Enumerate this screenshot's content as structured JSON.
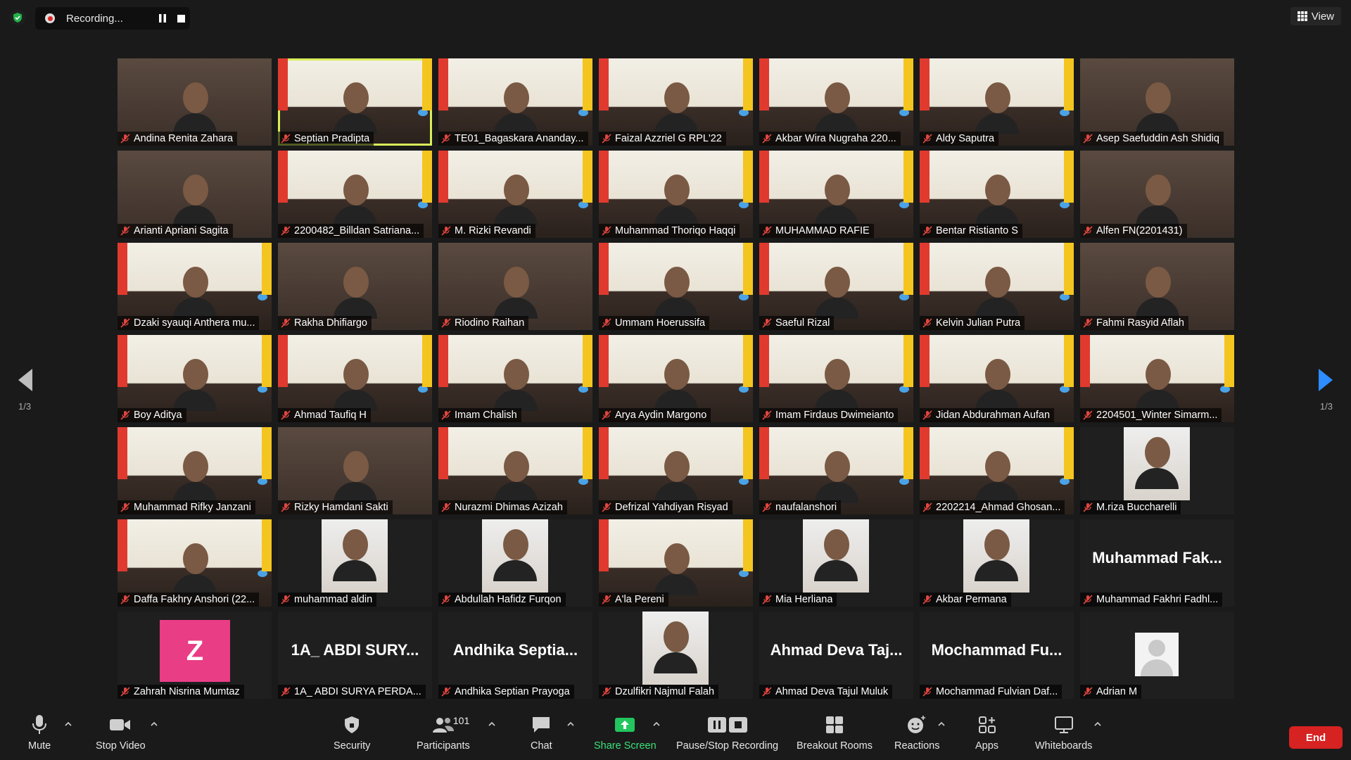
{
  "recording": {
    "label": "Recording..."
  },
  "view": {
    "label": "View"
  },
  "pagination": {
    "left": "1/3",
    "right": "1/3"
  },
  "participants_grid": [
    {
      "name": "Andina Renita Zahara",
      "type": "cam"
    },
    {
      "name": "Septian Pradipta",
      "type": "video",
      "active": true
    },
    {
      "name": "TE01_Bagaskara Ananday...",
      "type": "video"
    },
    {
      "name": "Faizal Azzriel G RPL'22",
      "type": "video"
    },
    {
      "name": "Akbar Wira Nugraha 220...",
      "type": "video"
    },
    {
      "name": "Aldy Saputra",
      "type": "video"
    },
    {
      "name": "Asep Saefuddin Ash Shidiq",
      "type": "cam"
    },
    {
      "name": "Arianti Apriani Sagita",
      "type": "cam"
    },
    {
      "name": "2200482_Billdan Satriana...",
      "type": "video"
    },
    {
      "name": "M. Rizki Revandi",
      "type": "video"
    },
    {
      "name": "Muhammad Thoriqo Haqqi",
      "type": "video"
    },
    {
      "name": "MUHAMMAD RAFIE",
      "type": "video"
    },
    {
      "name": "Bentar Ristianto S",
      "type": "video"
    },
    {
      "name": "Alfen FN(2201431)",
      "type": "cam"
    },
    {
      "name": "Dzaki syauqi Anthera mu...",
      "type": "video"
    },
    {
      "name": "Rakha Dhifiargo",
      "type": "cam"
    },
    {
      "name": "Riodino Raihan",
      "type": "cam"
    },
    {
      "name": "Ummam Hoerussifa",
      "type": "video"
    },
    {
      "name": "Saeful Rizal",
      "type": "video"
    },
    {
      "name": "Kelvin Julian Putra",
      "type": "video"
    },
    {
      "name": "Fahmi Rasyid Aflah",
      "type": "cam"
    },
    {
      "name": "Boy Aditya",
      "type": "video"
    },
    {
      "name": "Ahmad Taufiq H",
      "type": "video"
    },
    {
      "name": "Imam Chalish",
      "type": "video"
    },
    {
      "name": "Arya Aydin Margono",
      "type": "video"
    },
    {
      "name": "Imam Firdaus Dwimeianto",
      "type": "video"
    },
    {
      "name": "Jidan Abdurahman Aufan",
      "type": "video"
    },
    {
      "name": "2204501_Winter Simarm...",
      "type": "video"
    },
    {
      "name": "Muhammad Rifky Janzani",
      "type": "video"
    },
    {
      "name": "Rizky Hamdani Sakti",
      "type": "cam"
    },
    {
      "name": "Nurazmi Dhimas Azizah",
      "type": "video"
    },
    {
      "name": "Defrizal Yahdiyan Risyad",
      "type": "video"
    },
    {
      "name": "naufalanshori",
      "type": "video"
    },
    {
      "name": "2202214_Ahmad Ghosan...",
      "type": "video"
    },
    {
      "name": "M.riza Buccharelli",
      "type": "photo"
    },
    {
      "name": "Daffa Fakhry Anshori (22...",
      "type": "video"
    },
    {
      "name": "muhammad aldin",
      "type": "photo"
    },
    {
      "name": "Abdullah Hafidz Furqon",
      "type": "photo"
    },
    {
      "name": "A'la Pereni",
      "type": "video"
    },
    {
      "name": "Mia Herliana",
      "type": "photo"
    },
    {
      "name": "Akbar Permana",
      "type": "photo"
    },
    {
      "name": "Muhammad Fakhri Fadhl...",
      "type": "text",
      "big": "Muhammad  Fak..."
    },
    {
      "name": "Zahrah Nisrina Mumtaz",
      "type": "letter",
      "letter": "Z"
    },
    {
      "name": "1A_ ABDI SURYA PERDA...",
      "type": "text",
      "big": "1A_ ABDI SURY..."
    },
    {
      "name": "Andhika Septian Prayoga",
      "type": "text",
      "big": "Andhika  Septia..."
    },
    {
      "name": "Dzulfikri Najmul Falah",
      "type": "photo"
    },
    {
      "name": "Ahmad Deva Tajul Muluk",
      "type": "text",
      "big": "Ahmad  Deva  Taj..."
    },
    {
      "name": "Mochammad Fulvian Daf...",
      "type": "text",
      "big": "Mochammad  Fu..."
    },
    {
      "name": "Adrian M",
      "type": "default"
    }
  ],
  "toolbar": {
    "mute": "Mute",
    "stop_video": "Stop Video",
    "security": "Security",
    "participants": "Participants",
    "participants_count": "101",
    "chat": "Chat",
    "share_screen": "Share Screen",
    "pause_stop_recording": "Pause/Stop Recording",
    "breakout_rooms": "Breakout Rooms",
    "reactions": "Reactions",
    "apps": "Apps",
    "whiteboards": "Whiteboards",
    "end": "End"
  },
  "colors": {
    "accent_green": "#3ce07a",
    "end_red": "#d72222",
    "active_speaker": "#d9ee5a",
    "arrow_blue": "#2d8cff"
  }
}
